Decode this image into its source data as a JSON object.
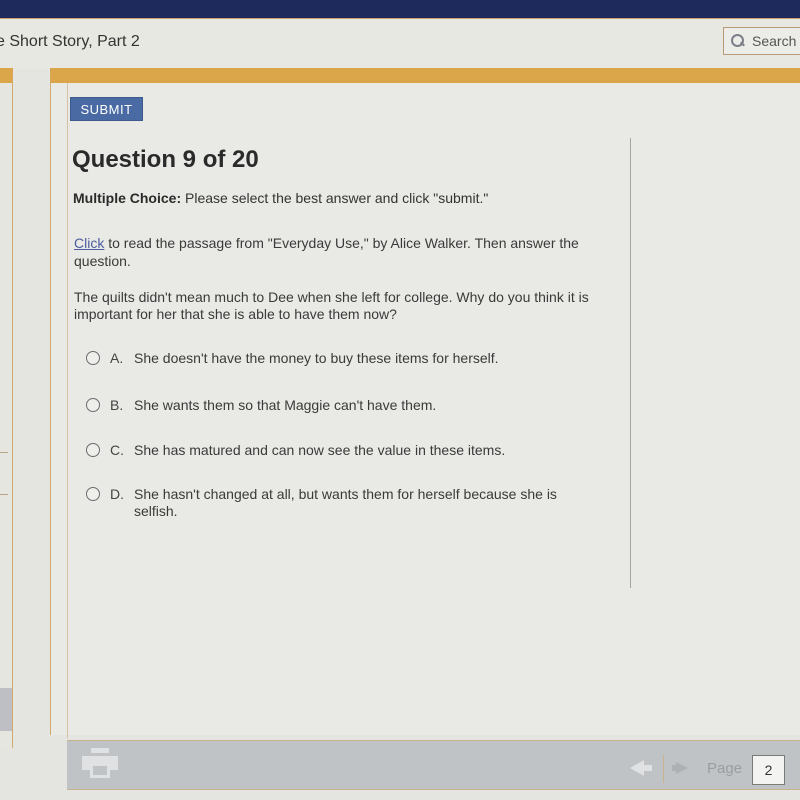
{
  "header": {
    "course_title": "e Short Story, Part 2",
    "search_label": "Search",
    "search_icon": "magnifier-icon"
  },
  "toolbar": {
    "submit_label": "SUBMIT"
  },
  "question": {
    "title": "Question 9 of 20",
    "instruction_type": "Multiple Choice:",
    "instruction_text": " Please select the best answer and click \"submit.\"",
    "passage_link_label": "Click",
    "passage_text": " to read the passage from \"Everyday Use,\" by Alice Walker. Then answer the question.",
    "prompt": "The quilts didn't mean much to Dee when she left for college. Why do you think it is important for her that she is able to have them now?",
    "options": [
      {
        "letter": "A.",
        "text": "She doesn't have the money to buy these items for herself."
      },
      {
        "letter": "B.",
        "text": "She wants them so that Maggie can't have them."
      },
      {
        "letter": "C.",
        "text": "She has matured and can now see the value in these items."
      },
      {
        "letter": "D.",
        "text": "She hasn't changed at all, but wants them for herself because she is selfish."
      }
    ],
    "selected_option": null
  },
  "footer": {
    "print_icon": "printer-icon",
    "prev_icon": "arrow-left-icon",
    "next_icon": "arrow-right-icon",
    "page_label": "Page",
    "page_value": "2"
  },
  "colors": {
    "top_bar": "#1f2a5c",
    "accent_bar": "#dba64a",
    "submit_button": "#4a6aa3",
    "link": "#4e5ea0",
    "footer_bar": "#c0c3c6"
  }
}
